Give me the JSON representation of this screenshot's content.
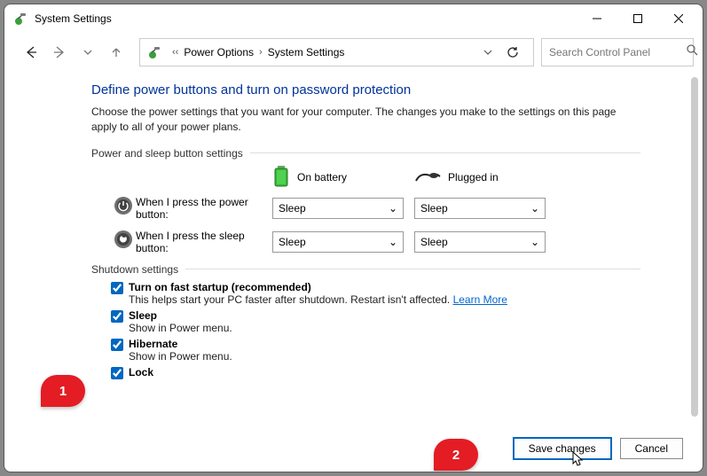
{
  "window": {
    "title": "System Settings"
  },
  "nav": {
    "breadcrumb": [
      "Power Options",
      "System Settings"
    ],
    "search_placeholder": "Search Control Panel"
  },
  "page": {
    "title": "Define power buttons and turn on password protection",
    "desc": "Choose the power settings that you want for your computer. The changes you make to the settings on this page apply to all of your power plans."
  },
  "power_section": {
    "label": "Power and sleep button settings",
    "col_battery": "On battery",
    "col_plugged": "Plugged in",
    "rows": [
      {
        "label": "When I press the power button:",
        "battery": "Sleep",
        "plugged": "Sleep"
      },
      {
        "label": "When I press the sleep button:",
        "battery": "Sleep",
        "plugged": "Sleep"
      }
    ]
  },
  "shutdown_section": {
    "label": "Shutdown settings",
    "items": [
      {
        "name": "Turn on fast startup (recommended)",
        "desc": "This helps start your PC faster after shutdown. Restart isn't affected. ",
        "link": "Learn More",
        "checked": true
      },
      {
        "name": "Sleep",
        "desc": "Show in Power menu.",
        "checked": true
      },
      {
        "name": "Hibernate",
        "desc": "Show in Power menu.",
        "checked": true
      },
      {
        "name": "Lock",
        "desc": "",
        "checked": true
      }
    ]
  },
  "footer": {
    "save": "Save changes",
    "cancel": "Cancel"
  },
  "annotations": {
    "badge1": "1",
    "badge2": "2"
  }
}
